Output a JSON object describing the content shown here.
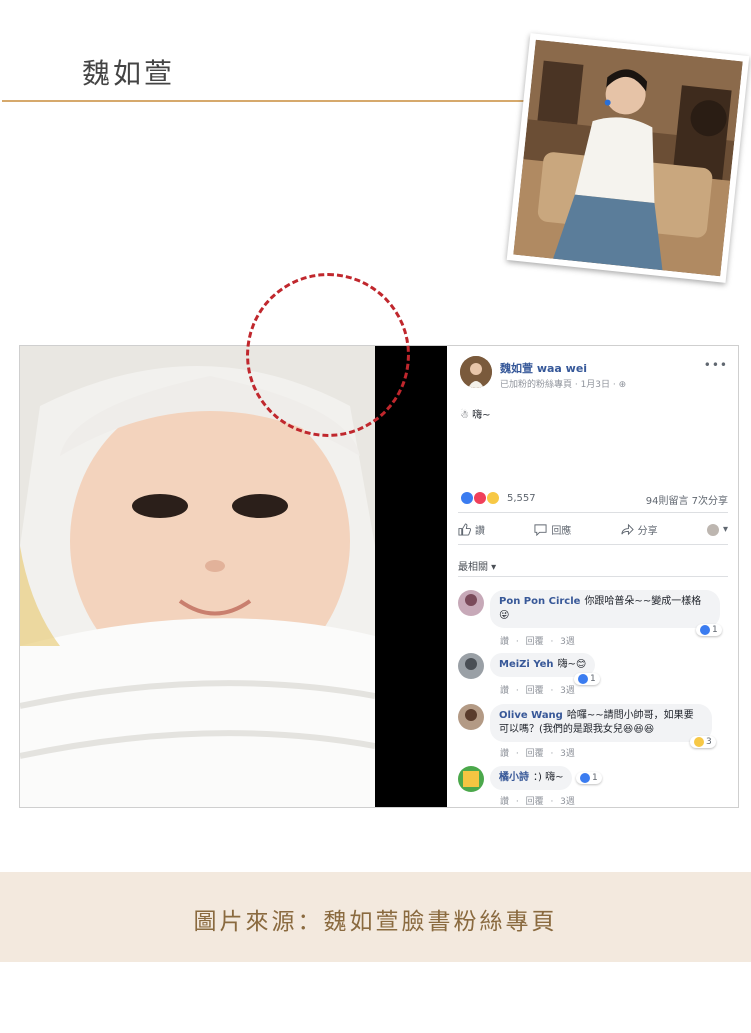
{
  "article": {
    "person_name": "魏如萱",
    "credit": "圖片來源：魏如萱臉書粉絲專頁"
  },
  "post": {
    "page_name": "魏如萱 waa wei",
    "meta": "已加粉的粉絲專頁 · 1月3日 · ⊕",
    "more": "•••",
    "text": "☃ 嗨~",
    "reaction_count": "5,557",
    "comments_shares": "94則留言 7次分享",
    "actions": {
      "like": "讚",
      "comment": "回應",
      "share": "分享"
    },
    "sort_label": "最相關 ▾"
  },
  "comments": [
    {
      "author": "Pon Pon Circle",
      "text": "你跟哈普朵~~變成一樣格😜",
      "meta": "讚 · 回覆 · 3週",
      "reaction": "1"
    },
    {
      "author": "MeiZi Yeh",
      "text": "嗨~😊",
      "meta": "讚 · 回覆 · 3週",
      "reaction": "1"
    },
    {
      "author": "Olive Wang",
      "text": "哈囉~~請問小帥哥，如果要可以嗎？(我們的是跟我女兒😆😆😆",
      "meta": "讚 · 回覆 · 3週",
      "reaction": "3"
    },
    {
      "author": "橘小詩",
      "text": "：) 嗨~",
      "meta": "讚 · 回覆 · 3週",
      "reaction": "1"
    }
  ],
  "colors": {
    "accent": "#d6a96c",
    "link": "#365899",
    "highlight_circle": "#c0272d",
    "credit_bg": "#f3e9de"
  }
}
